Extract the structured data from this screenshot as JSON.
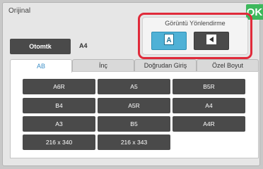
{
  "header": {
    "title": "Orijinal",
    "ok_label": "OK"
  },
  "selection": {
    "auto_label": "Otomtk",
    "current_size": "A4"
  },
  "orientation": {
    "title": "Görüntü Yönlendirme",
    "portrait_icon": "portrait-A-icon",
    "landscape_icon": "landscape-arrow-icon",
    "highlight_color": "#e02a3a",
    "active_color": "#4fb1d6"
  },
  "tabs": [
    {
      "label": "AB",
      "active": true
    },
    {
      "label": "İnç",
      "active": false
    },
    {
      "label": "Doğrudan Giriş",
      "active": false
    },
    {
      "label": "Özel Boyut",
      "active": false
    }
  ],
  "sizes": [
    {
      "label": "A6R"
    },
    {
      "label": "A5"
    },
    {
      "label": "B5R"
    },
    {
      "label": "B4"
    },
    {
      "label": "A5R"
    },
    {
      "label": "A4"
    },
    {
      "label": "A3"
    },
    {
      "label": "B5"
    },
    {
      "label": "A4R"
    },
    {
      "label": "216 x 340"
    },
    {
      "label": "216 x 343"
    }
  ]
}
